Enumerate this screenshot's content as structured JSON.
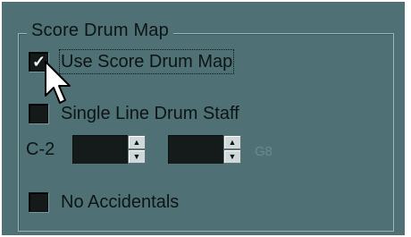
{
  "group": {
    "title": "Score Drum Map"
  },
  "options": {
    "use_score_drum_map": {
      "label": "Use Score Drum Map",
      "checked": true
    },
    "single_line_drum_staff": {
      "label": "Single Line Drum Staff",
      "checked": false
    },
    "no_accidentals": {
      "label": "No Accidentals",
      "checked": false
    }
  },
  "range": {
    "low_label": "C-2",
    "low_value": "",
    "high_value": "",
    "high_label": "G8"
  },
  "icons": {
    "checkmark": "check-icon",
    "cursor": "mouse-pointer-icon",
    "spin_up": "arrow-up-icon",
    "spin_down": "arrow-down-icon"
  },
  "colors": {
    "panel_background": "#4f7175",
    "field_background": "#151b1b",
    "text": "#0c1414",
    "disabled_text": "#6c8a8d"
  }
}
